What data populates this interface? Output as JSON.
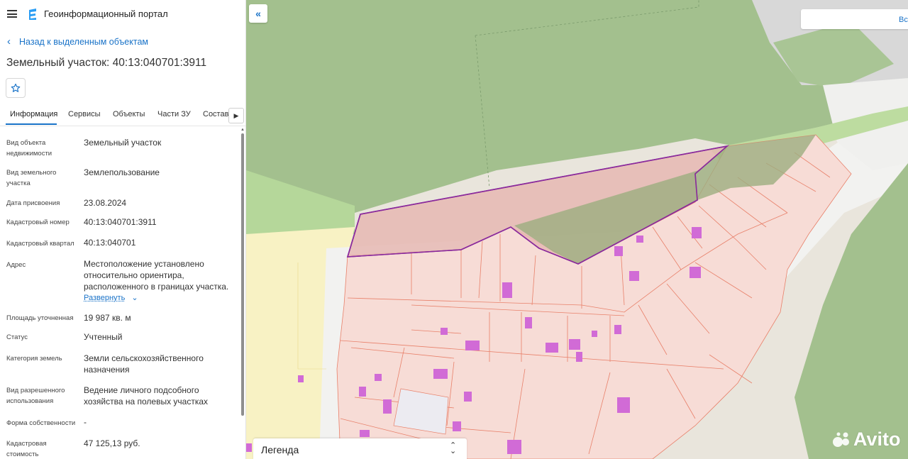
{
  "header": {
    "app_title": "Геоинформационный портал"
  },
  "nav": {
    "back_label": "Назад к выделенным объектам"
  },
  "object": {
    "title": "Земельный участок: 40:13:040701:3911"
  },
  "tabs": [
    {
      "label": "Информация",
      "active": true
    },
    {
      "label": "Сервисы"
    },
    {
      "label": "Объекты"
    },
    {
      "label": "Части ЗУ"
    },
    {
      "label": "Состав"
    }
  ],
  "info": [
    {
      "label": "Вид объекта недвижимости",
      "value": "Земельный участок"
    },
    {
      "label": "Вид земельного участка",
      "value": "Землепользование"
    },
    {
      "label": "Дата присвоения",
      "value": "23.08.2024"
    },
    {
      "label": "Кадастровый номер",
      "value": "40:13:040701:3911"
    },
    {
      "label": "Кадастровый квартал",
      "value": "40:13:040701"
    },
    {
      "label": "Адрес",
      "value": "Местоположение установлено относительно ориентира, расположенного в границах участка."
    },
    {
      "label": "Площадь уточненная",
      "value": "19 987 кв. м"
    },
    {
      "label": "Статус",
      "value": "Учтенный"
    },
    {
      "label": "Категория земель",
      "value": "Земли сельскохозяйственного назначения"
    },
    {
      "label": "Вид разрешенного использования",
      "value": "Ведение личного подсобного хозяйства на полевых участках"
    },
    {
      "label": "Форма собственности",
      "value": "-"
    },
    {
      "label": "Кадастровая стоимость",
      "value": "47 125,13 руб."
    }
  ],
  "expand_label": "Развернуть",
  "map": {
    "search_label": "Вс",
    "legend_label": "Легенда",
    "watermark": "Avito"
  },
  "colors": {
    "accent": "#1a73c8",
    "forest": "#a3c08e",
    "parcel_fill": "#f7dcd6",
    "parcel_line": "#e8806a",
    "selected_outline": "#8a2a9c",
    "building": "#d16bd6"
  },
  "icons": {
    "menu": "hamburger-icon",
    "logo": "portal-logo-icon",
    "back": "chevron-left-icon",
    "favorite": "star-icon",
    "collapse": "double-chevron-left-icon",
    "legend_toggle": "sort-arrows-icon"
  }
}
